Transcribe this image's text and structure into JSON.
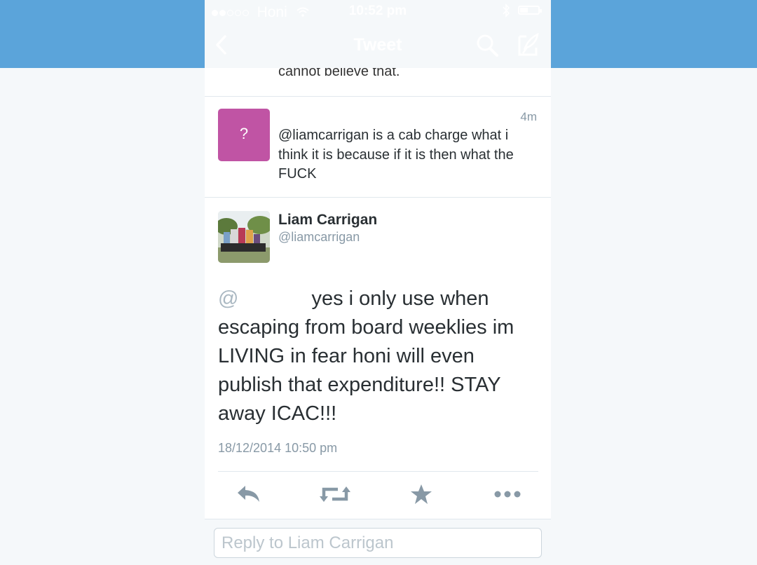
{
  "colors": {
    "brand": "#5ba4da",
    "avatar_pink": "#c054a4",
    "icon_gray": "#8899a6"
  },
  "statusbar": {
    "carrier": "Honi",
    "time": "10:52 pm"
  },
  "navbar": {
    "title": "Tweet",
    "icons": [
      "back-chevron-icon",
      "search-icon",
      "compose-icon"
    ]
  },
  "previous_tweet": {
    "text_snippet": "cannot believe that."
  },
  "reply_tweet": {
    "avatar_label": "?",
    "time": "4m",
    "text": "@liamcarrigan is a cab charge what i think it is because if it is then what the FUCK"
  },
  "main_tweet": {
    "name": "Liam Carrigan",
    "handle": "@liamcarrigan",
    "mention_prefix": "@",
    "text": "yes i only use when escaping from board weeklies im LIVING in fear honi will even publish that expenditure!! STAY away ICAC!!!",
    "timestamp": "18/12/2014 10:50 pm",
    "actions": [
      "reply-icon",
      "retweet-icon",
      "favorite-star-icon",
      "more-icon"
    ]
  },
  "reply_box": {
    "placeholder": "Reply to Liam Carrigan"
  }
}
